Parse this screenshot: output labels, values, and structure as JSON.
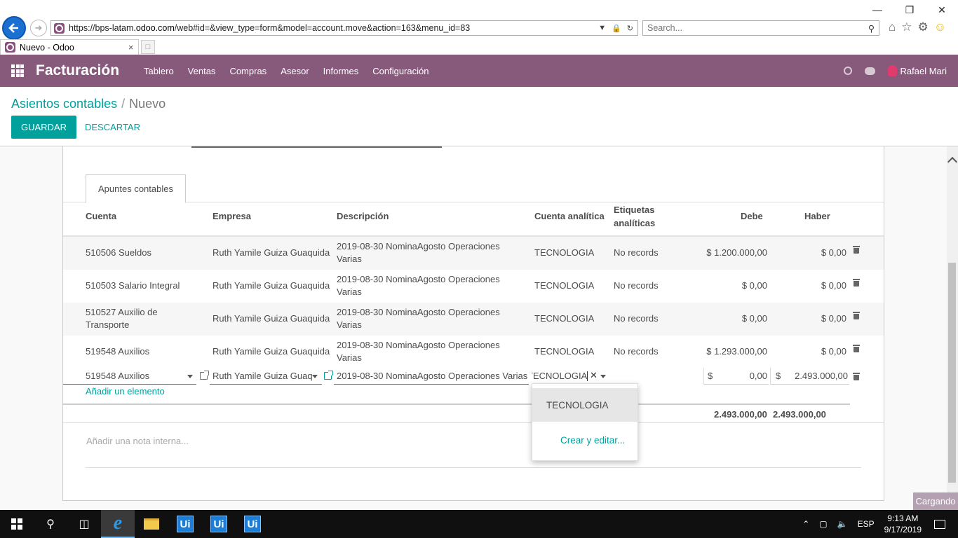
{
  "browser": {
    "url_prefix": "https://bps-latam.",
    "url_domain": "odoo.com",
    "url_suffix": "/web#id=&view_type=form&model=account.move&action=163&menu_id=83",
    "search_placeholder": "Search...",
    "tab_title": "Nuevo - Odoo",
    "tab_close": "×"
  },
  "navbar": {
    "app_name": "Facturación",
    "menu": [
      "Tablero",
      "Ventas",
      "Compras",
      "Asesor",
      "Informes",
      "Configuración"
    ],
    "user": "Rafael Mari"
  },
  "control_panel": {
    "breadcrumb_parent": "Asientos contables",
    "breadcrumb_sep": "/",
    "breadcrumb_current": "Nuevo",
    "save_label": "GUARDAR",
    "discard_label": "DESCARTAR"
  },
  "notebook": {
    "tab_label": "Apuntes contables"
  },
  "table": {
    "headers": {
      "cuenta": "Cuenta",
      "empresa": "Empresa",
      "descripcion": "Descripción",
      "cuenta_analitica": "Cuenta analítica",
      "etiquetas_1": "Etiquetas",
      "etiquetas_2": "analíticas",
      "debe": "Debe",
      "haber": "Haber"
    },
    "rows": [
      {
        "cuenta": "510506 Sueldos",
        "empresa": "Ruth Yamile Guiza Guaquida",
        "desc1": "2019-08-30 NominaAgosto Operaciones",
        "desc2": "Varias",
        "analitica": "TECNOLOGIA",
        "etiquetas": "No records",
        "debe": "$ 1.200.000,00",
        "haber": "$ 0,00"
      },
      {
        "cuenta": "510503 Salario Integral",
        "empresa": "Ruth Yamile Guiza Guaquida",
        "desc1": "2019-08-30 NominaAgosto Operaciones",
        "desc2": "Varias",
        "analitica": "TECNOLOGIA",
        "etiquetas": "No records",
        "debe": "$ 0,00",
        "haber": "$ 0,00"
      },
      {
        "cuenta": "510527 Auxilio de",
        "cuenta2": "Transporte",
        "empresa": "Ruth Yamile Guiza Guaquida",
        "desc1": "2019-08-30 NominaAgosto Operaciones",
        "desc2": "Varias",
        "analitica": "TECNOLOGIA",
        "etiquetas": "No records",
        "debe": "$ 0,00",
        "haber": "$ 0,00"
      },
      {
        "cuenta": "519548 Auxilios",
        "empresa": "Ruth Yamile Guiza Guaquida",
        "desc1": "2019-08-30 NominaAgosto Operaciones",
        "desc2": "Varias",
        "analitica": "TECNOLOGIA",
        "etiquetas": "No records",
        "debe": "$ 1.293.000,00",
        "haber": "$ 0,00"
      }
    ],
    "edit_row": {
      "cuenta": "519548 Auxilios",
      "empresa": "Ruth Yamile Guiza Guaq",
      "descripcion": "2019-08-30 NominaAgosto Operaciones Varias",
      "analitica": "TECNOLOGIA",
      "clear": "✕",
      "currency": "$",
      "debe": "0,00",
      "haber": "2.493.000,00"
    },
    "add_line": "Añadir un elemento",
    "total_debe": "2.493.000,00",
    "total_haber": "2.493.000,00",
    "note_placeholder": "Añadir una nota interna..."
  },
  "dropdown": {
    "options": [
      "TECNOLOGIA"
    ],
    "create_edit": "Crear y editar..."
  },
  "status": {
    "loading": "Cargando"
  },
  "taskbar": {
    "language": "ESP",
    "time": "9:13 AM",
    "date": "9/17/2019"
  },
  "colors": {
    "brand": "#875a7b",
    "accent": "#00a09d"
  }
}
